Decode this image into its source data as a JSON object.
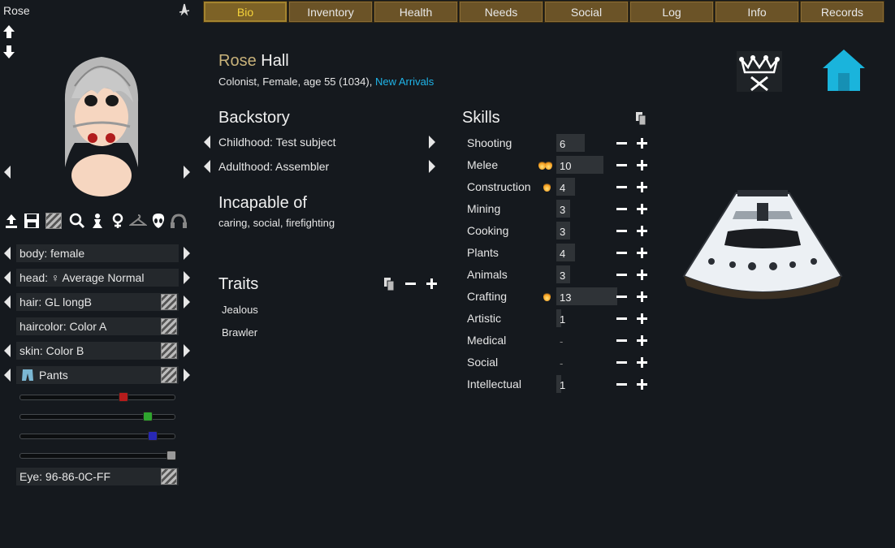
{
  "window": {
    "name": "Rose"
  },
  "tabs": [
    "Bio",
    "Inventory",
    "Health",
    "Needs",
    "Social",
    "Log",
    "Info",
    "Records"
  ],
  "active_tab": "Bio",
  "pawn": {
    "first_name": "Rose",
    "last_name": "Hall",
    "description": "Colonist, Female, age 55 (1034),",
    "faction_link": "New Arrivals"
  },
  "backstory": {
    "heading": "Backstory",
    "childhood": "Childhood: Test subject",
    "adulthood": "Adulthood: Assembler"
  },
  "incapable": {
    "heading": "Incapable of",
    "text": "caring, social, firefighting"
  },
  "traits": {
    "heading": "Traits",
    "items": [
      "Jealous",
      "Brawler"
    ]
  },
  "skills": {
    "heading": "Skills",
    "items": [
      {
        "name": "Shooting",
        "value": "6",
        "level": 6,
        "passion": 0
      },
      {
        "name": "Melee",
        "value": "10",
        "level": 10,
        "passion": 2
      },
      {
        "name": "Construction",
        "value": "4",
        "level": 4,
        "passion": 1
      },
      {
        "name": "Mining",
        "value": "3",
        "level": 3,
        "passion": 0
      },
      {
        "name": "Cooking",
        "value": "3",
        "level": 3,
        "passion": 0
      },
      {
        "name": "Plants",
        "value": "4",
        "level": 4,
        "passion": 0
      },
      {
        "name": "Animals",
        "value": "3",
        "level": 3,
        "passion": 0
      },
      {
        "name": "Crafting",
        "value": "13",
        "level": 13,
        "passion": 1
      },
      {
        "name": "Artistic",
        "value": "1",
        "level": 1,
        "passion": 0
      },
      {
        "name": "Medical",
        "value": "-",
        "level": 0,
        "passion": 0
      },
      {
        "name": "Social",
        "value": "-",
        "level": 0,
        "passion": 0
      },
      {
        "name": "Intellectual",
        "value": "1",
        "level": 1,
        "passion": 0
      }
    ]
  },
  "appearance": {
    "body": "body: female",
    "head": "head: ♀ Average Normal",
    "hair": "hair: GL longB",
    "haircolor": "haircolor: Color A",
    "skin": "skin: Color B",
    "apparel": "Pants",
    "eye": "Eye: 96-86-0C-FF"
  },
  "color_sliders": [
    {
      "name": "red",
      "value": 0.67,
      "color": "#b51c1c"
    },
    {
      "name": "green",
      "value": 0.84,
      "color": "#2ea42e"
    },
    {
      "name": "blue",
      "value": 0.87,
      "color": "#2828b4"
    },
    {
      "name": "alpha",
      "value": 1.0,
      "color": "#9a9a9a"
    }
  ],
  "colors": {
    "accent_gold": "#f4d23a",
    "link": "#1fb4e8",
    "name_gold": "#c8b27a",
    "home": "#1ab4dc"
  }
}
